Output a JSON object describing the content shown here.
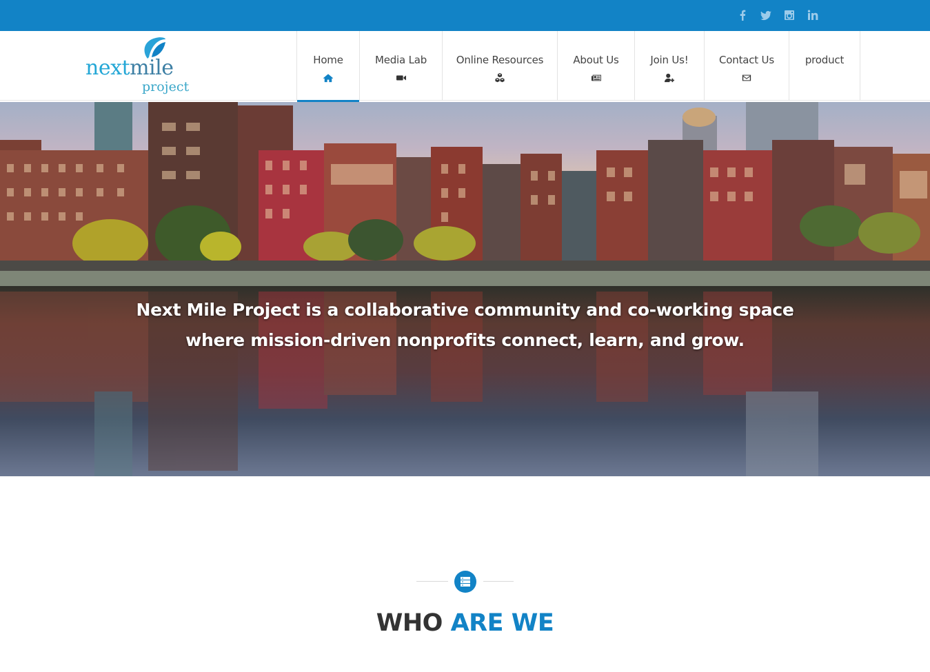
{
  "topbar": {
    "social": [
      {
        "icon": "facebook-icon"
      },
      {
        "icon": "twitter-icon"
      },
      {
        "icon": "instagram-icon"
      },
      {
        "icon": "linkedin-icon"
      }
    ]
  },
  "logo": {
    "word1": "next",
    "word2": "mile",
    "word3": "project"
  },
  "nav": {
    "items": [
      {
        "label": "Home",
        "icon": "home-icon"
      },
      {
        "label": "Media Lab",
        "icon": "video-camera-icon"
      },
      {
        "label": "Online Resources",
        "icon": "cubes-icon"
      },
      {
        "label": "About Us",
        "icon": "newspaper-icon"
      },
      {
        "label": "Join Us!",
        "icon": "user-plus-icon"
      },
      {
        "label": "Contact Us",
        "icon": "envelope-icon"
      },
      {
        "label": "product",
        "icon": ""
      }
    ],
    "active": "Home"
  },
  "hero": {
    "line1": "Next Mile Project is a collaborative community and co-working space",
    "line2": "where mission-driven nonprofits connect, learn, and grow."
  },
  "section": {
    "title_part1": "WHO ",
    "title_part2": "ARE WE",
    "icon": "server-icon"
  },
  "colors": {
    "accent": "#1283c6",
    "topbar": "#1283c6",
    "logo": "#24a7d6"
  }
}
